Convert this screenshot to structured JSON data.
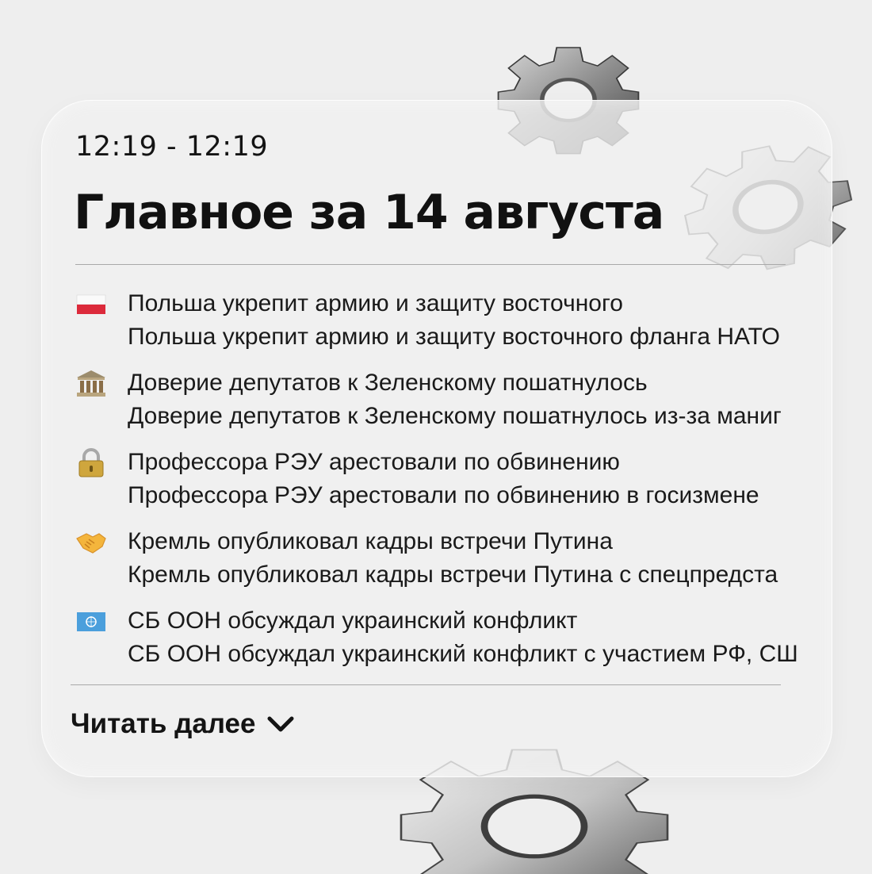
{
  "digest": {
    "time_range": "12:19 - 12:19",
    "title": "Главное за 14 августа",
    "items": [
      {
        "icon": "poland-flag-icon",
        "headline": "Польша укрепит армию и защиту восточного",
        "summary": "Польша укрепит армию и защиту восточного фланга НАТО"
      },
      {
        "icon": "classical-building-icon",
        "headline": "Доверие депутатов к Зеленскому пошатнулось",
        "summary": "Доверие депутатов к Зеленскому пошатнулось из-за маниг"
      },
      {
        "icon": "padlock-icon",
        "headline": "Профессора РЭУ арестовали по обвинению",
        "summary": "Профессора РЭУ арестовали по обвинению в госизмене"
      },
      {
        "icon": "handshake-icon",
        "headline": "Кремль опубликовал кадры встречи Путина",
        "summary": "Кремль опубликовал кадры встречи Путина с спецпредста"
      },
      {
        "icon": "united-nations-flag-icon",
        "headline": "СБ ООН обсуждал украинский конфликт",
        "summary": "СБ ООН обсуждал украинский конфликт с участием РФ, СШ"
      }
    ],
    "read_more_label": "Читать далее",
    "read_more_icon": "chevron-down-icon"
  },
  "decor": {
    "gear_icon": "gear-icon",
    "metal_color": "#9a9a9a"
  }
}
